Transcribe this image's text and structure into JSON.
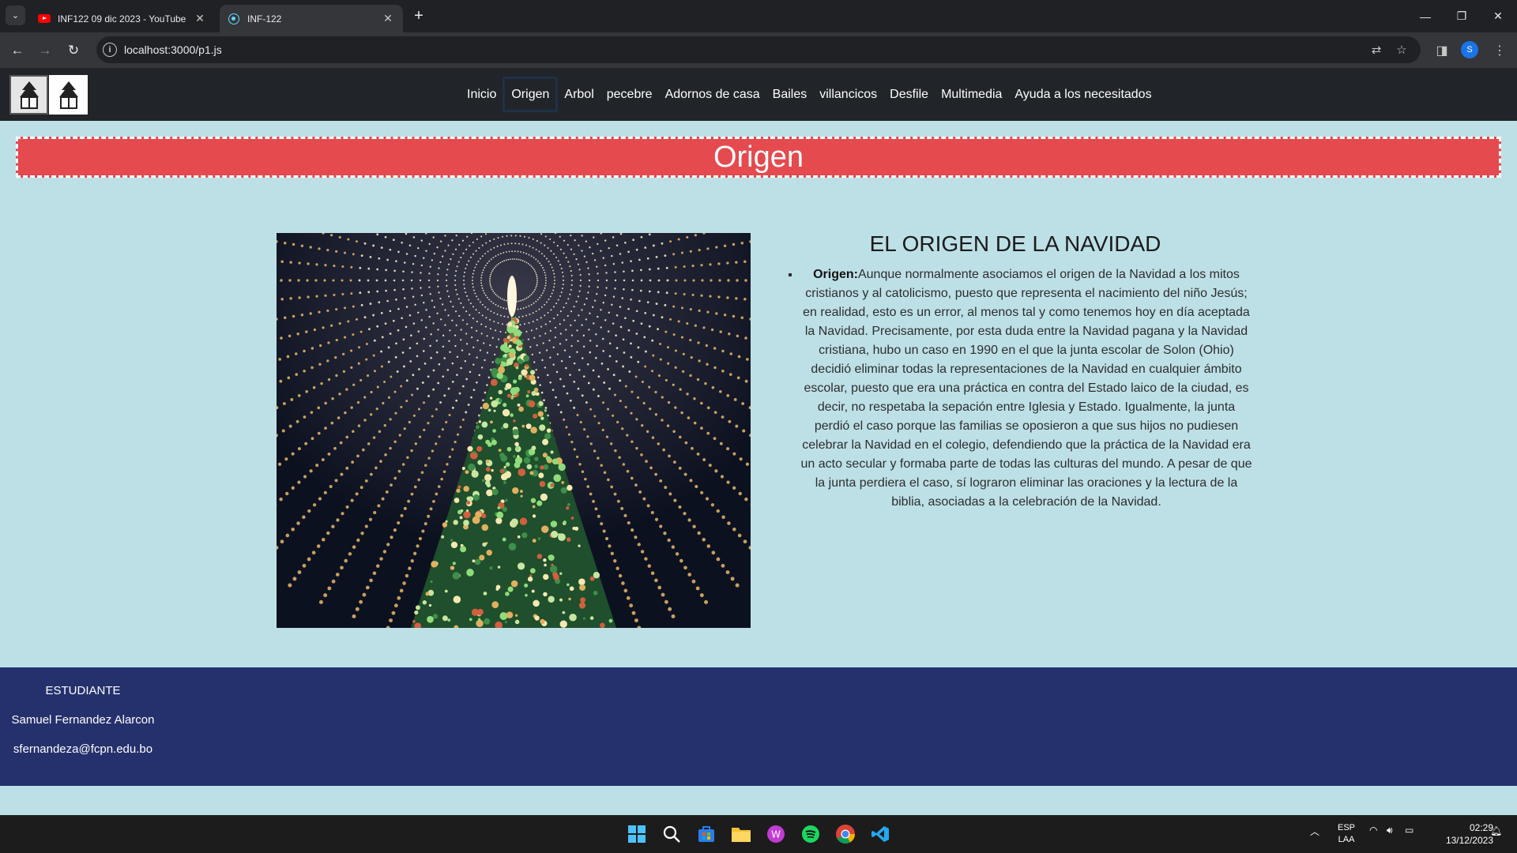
{
  "browser": {
    "tabs": [
      {
        "title": "INF122 09 dic 2023 - YouTube",
        "icon": "youtube-icon"
      },
      {
        "title": "INF-122",
        "icon": "react-icon"
      }
    ],
    "url": "localhost:3000/p1.js",
    "profile_initial": "S"
  },
  "site": {
    "nav": [
      "Inicio",
      "Origen",
      "Arbol",
      "pecebre",
      "Adornos de casa",
      "Bailes",
      "villancicos",
      "Desfile",
      "Multimedia",
      "Ayuda a los necesitados"
    ],
    "active_nav": "Origen",
    "banner_title": "Origen",
    "heading": "EL ORIGEN DE LA NAVIDAD",
    "paragraph_label": "Origen:",
    "paragraph_text": "Aunque normalmente asociamos el origen de la Navidad a los mitos cristianos y al catolicismo, puesto que representa el nacimiento del niño Jesús; en realidad, esto es un error, al menos tal y como tenemos hoy en día aceptada la Navidad. Precisamente, por esta duda entre la Navidad pagana y la Navidad cristiana, hubo un caso en 1990 en el que la junta escolar de Solon (Ohio) decidió eliminar todas la representaciones de la Navidad en cualquier ámbito escolar, puesto que era una práctica en contra del Estado laico de la ciudad, es decir, no respetaba la sepación entre Iglesia y Estado. Igualmente, la junta perdió el caso porque las familias se oposieron a que sus hijos no pudiesen celebrar la Navidad en el colegio, defendiendo que la práctica de la Navidad era un acto secular y formaba parte de todas las culturas del mundo. A pesar de que la junta perdiera el caso, sí lograron eliminar las oraciones y la lectura de la biblia, asociadas a la celebración de la Navidad.",
    "footer": {
      "role": "ESTUDIANTE",
      "name": "Samuel Fernandez Alarcon",
      "email": "sfernandeza@fcpn.edu.bo"
    }
  },
  "taskbar": {
    "lang_line1": "ESP",
    "lang_line2": "LAA",
    "time": "02:29",
    "date": "13/12/2023"
  },
  "colors": {
    "navbar": "#212529",
    "page_bg": "#bde0e6",
    "banner": "#e44a4e",
    "footer": "#25316d"
  }
}
